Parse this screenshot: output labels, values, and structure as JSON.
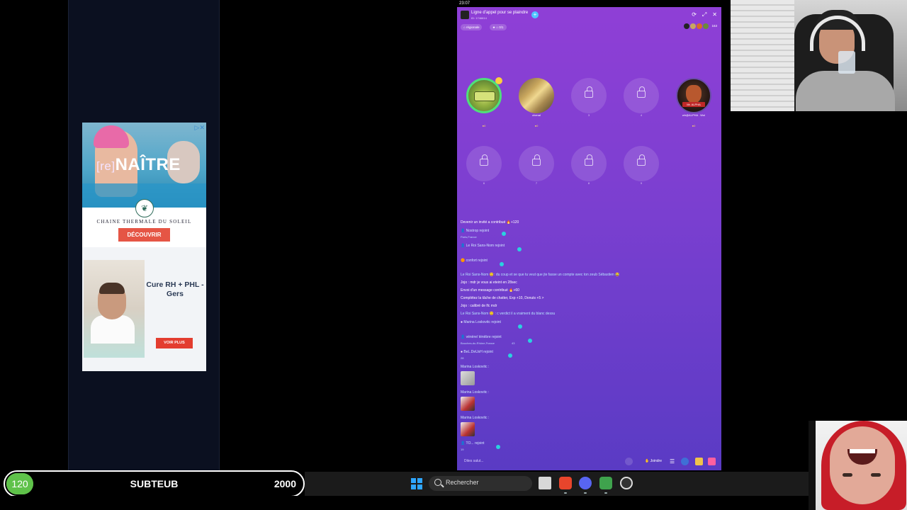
{
  "status_bar": {
    "time": "23:07"
  },
  "ad_top": {
    "headline_prefix": "[re]",
    "headline": "NAÎTRE",
    "brand": "CHAINE THERMALE DU SOLEIL",
    "cta": "DÉCOUVRIR",
    "close_icon": "close-icon"
  },
  "ad_bottom": {
    "title": "Cure RH + PHL - Gers",
    "cta": "VOIR PLUS"
  },
  "room": {
    "title": "Ligne d'appel pour se plaindre",
    "subtitle": "ID: 1746614",
    "tag_region": "régionale",
    "tag_stars": "0/1",
    "viewers": "163",
    "seats": [
      {
        "num": "1",
        "name": "",
        "badge": "●0",
        "state": "occupied"
      },
      {
        "num": "2",
        "name": "chenal",
        "badge": "●0",
        "state": "occupied"
      },
      {
        "num": "3",
        "name": "",
        "badge": "",
        "state": "locked"
      },
      {
        "num": "4",
        "name": "",
        "badge": "",
        "state": "locked"
      },
      {
        "num": "5",
        "name": "wh@ALPHA . Wol",
        "badge": "●0",
        "state": "occupied",
        "label": "Mr. ALPHA"
      },
      {
        "num": "6",
        "name": "",
        "badge": "",
        "state": "locked"
      },
      {
        "num": "7",
        "name": "",
        "badge": "",
        "state": "locked"
      },
      {
        "num": "8",
        "name": "",
        "badge": "",
        "state": "locked"
      },
      {
        "num": "9",
        "name": "",
        "badge": "",
        "state": "locked"
      }
    ]
  },
  "chat": {
    "lines": [
      {
        "text": "Devenir un invité a contribué 🔥+120"
      },
      {
        "text": "Nostrop rejoint"
      },
      {
        "sub": "Paris,France"
      },
      {
        "text": "Le Roi Sans-Nom rejoint"
      },
      {
        "text": "confort rejoint"
      },
      {
        "text": "Le Roi Sans-Nom 😊: du coup et se que tu veut que jte fasse un compte avec ton zeub Sébastien 😂"
      },
      {
        "text": "Jojo : mdr je vous ai eteint en 28sec"
      },
      {
        "text": "Envoi d'un message contribué 🔥+60"
      },
      {
        "text": "Complétez la tâche de chatter, Exp +10, Donuts +5 >"
      },
      {
        "text": "Jojo : calibré de lfc mdr"
      },
      {
        "text": "Le Roi Sans-Nom 😊 : c verdict il a vraiment du blanc dessu"
      },
      {
        "text": "Marina Loskovitc rejoint"
      },
      {
        "text": "vénère/ ténèbre rejoint"
      },
      {
        "sub": "Bouches-du-Rhône,France"
      },
      {
        "sub2": "43"
      },
      {
        "text": "BeL.DeUsH rejoint"
      },
      {
        "sub": "28"
      },
      {
        "text": "Marina Loskovitc :"
      },
      {
        "text": "Marina Loskovitc :"
      },
      {
        "text": "Marina Loskovitc :"
      },
      {
        "text": "TO... rejoint"
      },
      {
        "sub": "19"
      }
    ]
  },
  "bottom_bar": {
    "input_placeholder": "Dites salut...",
    "join_label": "Joindre"
  },
  "sub_goal": {
    "current": "120",
    "label": "SUBTEUB",
    "target": "2000",
    "progress_fraction": 0.06
  },
  "taskbar": {
    "search_placeholder": "Rechercher"
  }
}
